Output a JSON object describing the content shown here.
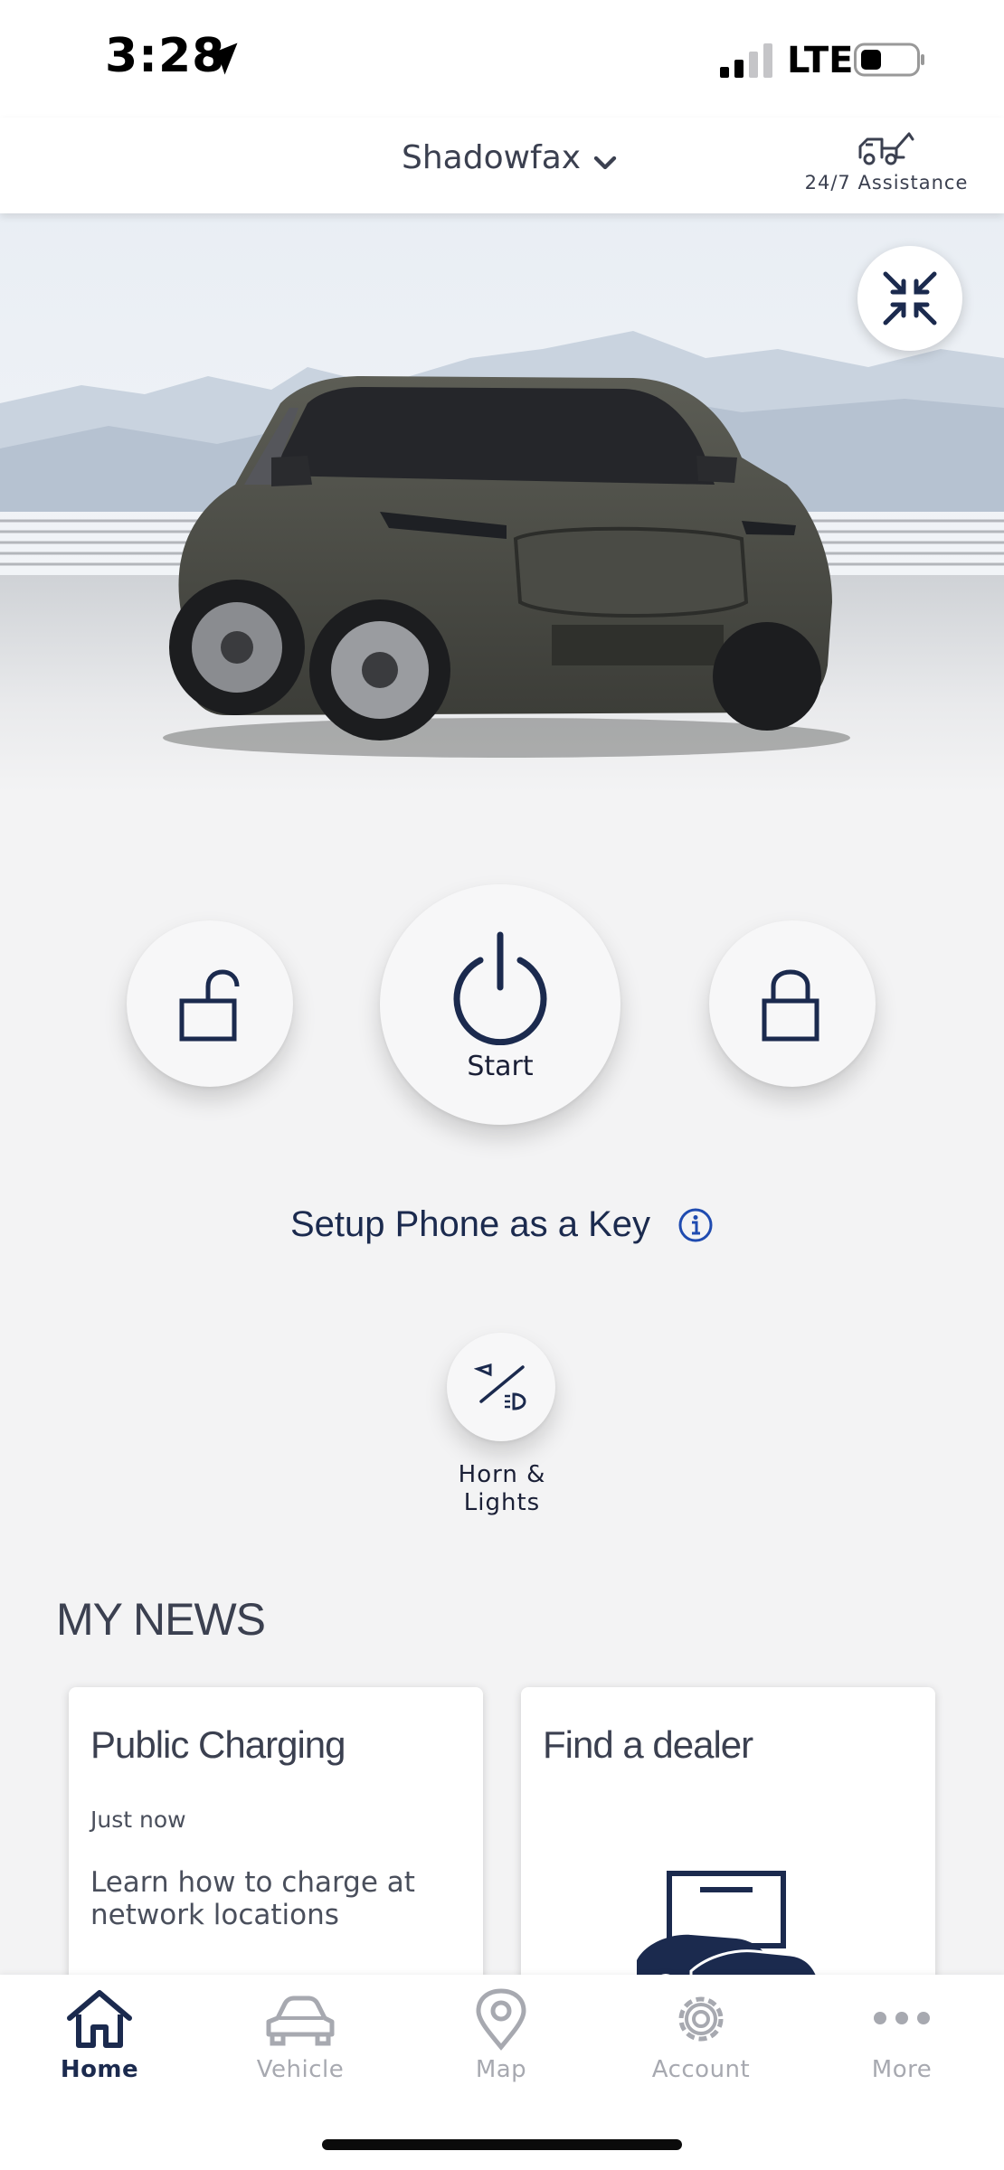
{
  "status_bar": {
    "time": "3:28",
    "network": "LTE"
  },
  "header": {
    "vehicle_name": "Shadowfax",
    "assistance_label": "24/7 Assistance"
  },
  "controls": {
    "start_label": "Start",
    "phone_key_label": "Setup Phone as a Key",
    "horn_lights_label": "Horn &\nLights"
  },
  "news": {
    "heading": "MY NEWS",
    "cards": [
      {
        "title": "Public Charging",
        "time": "Just now",
        "body": "Learn how to charge at network locations"
      },
      {
        "title": "Find a dealer"
      }
    ]
  },
  "tab_bar": {
    "tabs": [
      {
        "label": "Home",
        "icon": "home-icon",
        "active": true
      },
      {
        "label": "Vehicle",
        "icon": "car-icon",
        "active": false
      },
      {
        "label": "Map",
        "icon": "map-pin-icon",
        "active": false
      },
      {
        "label": "Account",
        "icon": "gear-icon",
        "active": false
      },
      {
        "label": "More",
        "icon": "more-dots-icon",
        "active": false
      }
    ]
  },
  "colors": {
    "accent": "#1b2a4e",
    "inactive_tab": "#a7a9b0",
    "background": "#f3f3f4",
    "info_blue": "#1f4bb0"
  }
}
